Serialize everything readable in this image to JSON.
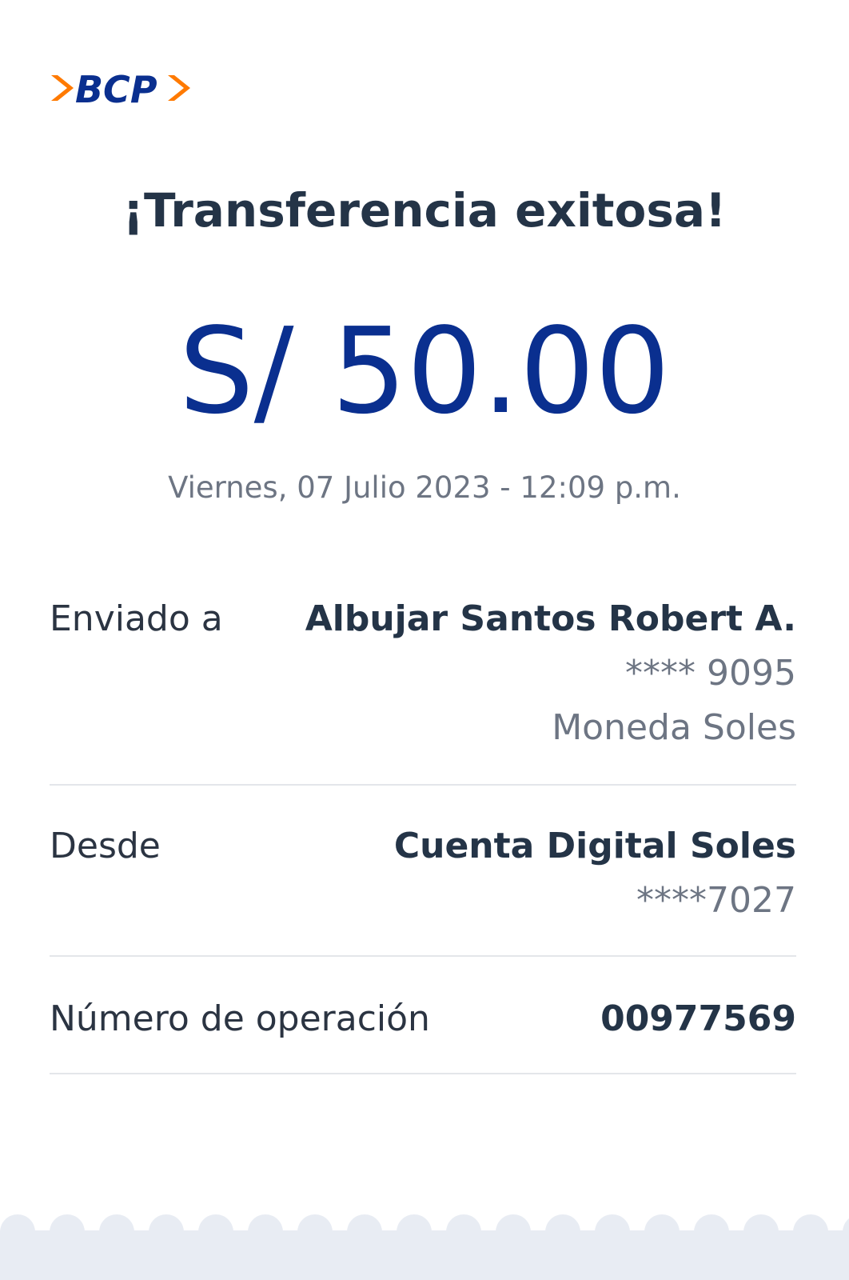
{
  "logo": {
    "text": "BCP",
    "colors": {
      "blue": "#0a2f8f",
      "orange": "#ff7a00"
    }
  },
  "header": {
    "title": "¡Transferencia exitosa!"
  },
  "amount": {
    "value": "S/ 50.00"
  },
  "datetime": "Viernes, 07 Julio 2023 - 12:09 p.m.",
  "details": {
    "sent_to": {
      "label": "Enviado a",
      "name": "Albujar Santos Robert A.",
      "account": "**** 9095",
      "currency": "Moneda Soles"
    },
    "from": {
      "label": "Desde",
      "account_name": "Cuenta Digital Soles",
      "account": "****7027"
    },
    "operation": {
      "label": "Número de operación",
      "number": "00977569"
    }
  },
  "colors": {
    "title": "#243447",
    "amount": "#0a2f8f",
    "muted": "#6d7583",
    "divider": "#e4e6ea",
    "footer": "#e8ecf3"
  }
}
